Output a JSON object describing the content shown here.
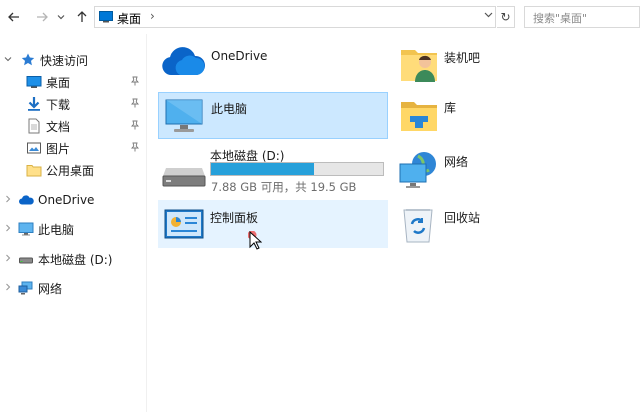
{
  "address_bar": {
    "back_icon": "arrow-left-icon",
    "forward_icon": "arrow-right-icon",
    "recent_icon": "chevron-down-icon",
    "up_icon": "arrow-up-icon",
    "path": "桌面",
    "separator": "›",
    "dropdown": "⌄",
    "refresh": "↻",
    "search_placeholder": "搜索\"桌面\""
  },
  "nav": {
    "items": [
      {
        "label": "快速访问",
        "icon": "star-icon"
      },
      {
        "label": "桌面",
        "icon": "desktop-icon"
      },
      {
        "label": "下载",
        "icon": "download-icon"
      },
      {
        "label": "文档",
        "icon": "document-icon"
      },
      {
        "label": "图片",
        "icon": "pictures-icon"
      },
      {
        "label": "公用桌面",
        "icon": "folder-icon"
      },
      {
        "label": "OneDrive",
        "icon": "cloud-icon"
      },
      {
        "label": "此电脑",
        "icon": "computer-icon"
      },
      {
        "label": "本地磁盘 (D:)",
        "icon": "drive-icon"
      },
      {
        "label": "网络",
        "icon": "network-icon"
      }
    ],
    "pin_glyph": "📌"
  },
  "content": {
    "items": [
      {
        "label": "OneDrive",
        "icon": "cloud-icon"
      },
      {
        "label": "装机吧",
        "icon": "user-folder-icon"
      },
      {
        "label": "此电脑",
        "icon": "computer-icon"
      },
      {
        "label": "库",
        "icon": "library-icon"
      },
      {
        "label": "本地磁盘 (D:)",
        "icon": "drive-icon"
      },
      {
        "label": "网络",
        "icon": "network-icon"
      },
      {
        "label": "控制面板",
        "icon": "control-panel-icon"
      },
      {
        "label": "回收站",
        "icon": "recycle-bin-icon"
      }
    ],
    "drive": {
      "free_text": "7.88 GB 可用，共 19.5 GB",
      "used_fraction": 0.596
    }
  },
  "colors": {
    "selected_bg": "#cce8ff",
    "hover_bg": "#e5f3ff",
    "drive_bar": "#26a0da",
    "accent_blue": "#0078d7"
  }
}
